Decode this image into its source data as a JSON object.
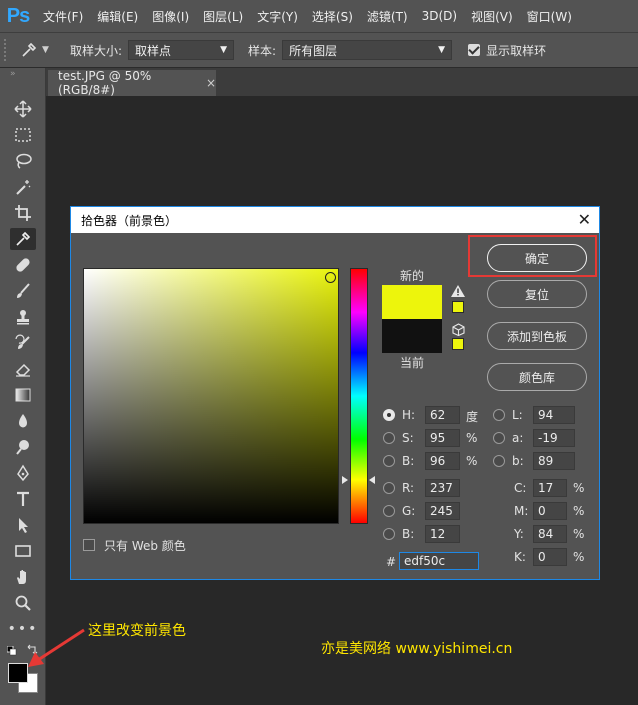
{
  "app": {
    "logo": "Ps"
  },
  "menu": [
    "文件(F)",
    "编辑(E)",
    "图像(I)",
    "图层(L)",
    "文字(Y)",
    "选择(S)",
    "滤镜(T)",
    "3D(D)",
    "视图(V)",
    "窗口(W)"
  ],
  "options": {
    "sample_size_label": "取样大小:",
    "sample_size_value": "取样点",
    "sample_label": "样本:",
    "sample_value": "所有图层",
    "show_ring_label": "显示取样环",
    "show_ring_checked": true
  },
  "document_tab": {
    "title": "test.JPG @ 50%(RGB/8#)",
    "close": "×"
  },
  "dialog": {
    "title": "拾色器（前景色）",
    "close": "✕",
    "new_label": "新的",
    "current_label": "当前",
    "new_color": "#edf50c",
    "current_color": "#111111",
    "buttons": {
      "ok": "确定",
      "reset": "复位",
      "add_swatch": "添加到色板",
      "libraries": "颜色库"
    },
    "hsb": {
      "h": {
        "label": "H:",
        "value": "62",
        "unit": "度"
      },
      "s": {
        "label": "S:",
        "value": "95",
        "unit": "%"
      },
      "b": {
        "label": "B:",
        "value": "96",
        "unit": "%"
      }
    },
    "rgb": {
      "r": {
        "label": "R:",
        "value": "237"
      },
      "g": {
        "label": "G:",
        "value": "245"
      },
      "b": {
        "label": "B:",
        "value": "12"
      }
    },
    "lab": {
      "l": {
        "label": "L:",
        "value": "94"
      },
      "a": {
        "label": "a:",
        "value": "-19"
      },
      "b": {
        "label": "b:",
        "value": "89"
      }
    },
    "cmyk": {
      "c": {
        "label": "C:",
        "value": "17",
        "unit": "%"
      },
      "m": {
        "label": "M:",
        "value": "0",
        "unit": "%"
      },
      "y": {
        "label": "Y:",
        "value": "84",
        "unit": "%"
      },
      "k": {
        "label": "K:",
        "value": "0",
        "unit": "%"
      }
    },
    "hex": {
      "label": "#",
      "value": "edf50c"
    },
    "web_only_label": "只有 Web 颜色"
  },
  "annotation": "这里改变前景色",
  "watermark": "亦是美网络 www.yishimei.cn"
}
